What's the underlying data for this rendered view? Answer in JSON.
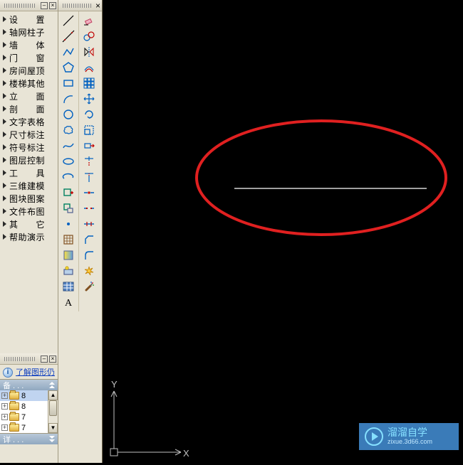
{
  "sidebar": {
    "items": [
      {
        "label": "设　　置"
      },
      {
        "label": "轴网柱子"
      },
      {
        "label": "墙　　体"
      },
      {
        "label": "门　　窗"
      },
      {
        "label": "房间屋顶"
      },
      {
        "label": "楼梯其他"
      },
      {
        "label": "立　　面"
      },
      {
        "label": "剖　　面"
      },
      {
        "label": "文字表格"
      },
      {
        "label": "尺寸标注"
      },
      {
        "label": "符号标注"
      },
      {
        "label": "图层控制"
      },
      {
        "label": "工　　具"
      },
      {
        "label": "三维建模"
      },
      {
        "label": "图块图案"
      },
      {
        "label": "文件布图"
      },
      {
        "label": "其　　它"
      },
      {
        "label": "帮助演示"
      }
    ]
  },
  "lower": {
    "link_text": "了解图形仍",
    "section1": {
      "title": "备 . . ."
    },
    "section2": {
      "title": "详 . . ."
    },
    "tree": [
      {
        "label": "8"
      },
      {
        "label": "8"
      },
      {
        "label": "7"
      },
      {
        "label": "7"
      }
    ]
  },
  "toolbox": {
    "col1": [
      "line",
      "construction-line",
      "polyline",
      "polygon",
      "rectangle",
      "arc",
      "circle",
      "revision-cloud",
      "spline",
      "ellipse",
      "ellipse-arc",
      "insert-block",
      "make-block",
      "point",
      "hatch",
      "gradient",
      "region",
      "table",
      "text"
    ],
    "col2": [
      "erase",
      "copy",
      "mirror",
      "offset",
      "array",
      "move",
      "rotate",
      "scale",
      "stretch",
      "trim",
      "extend",
      "break-at",
      "break",
      "join",
      "chamfer",
      "fillet",
      "explode",
      "paint"
    ]
  },
  "canvas": {
    "axis_x_label": "X",
    "axis_y_label": "Y"
  },
  "watermark": {
    "title": "溜溜自学",
    "sub": "zixue.3d66.com"
  }
}
